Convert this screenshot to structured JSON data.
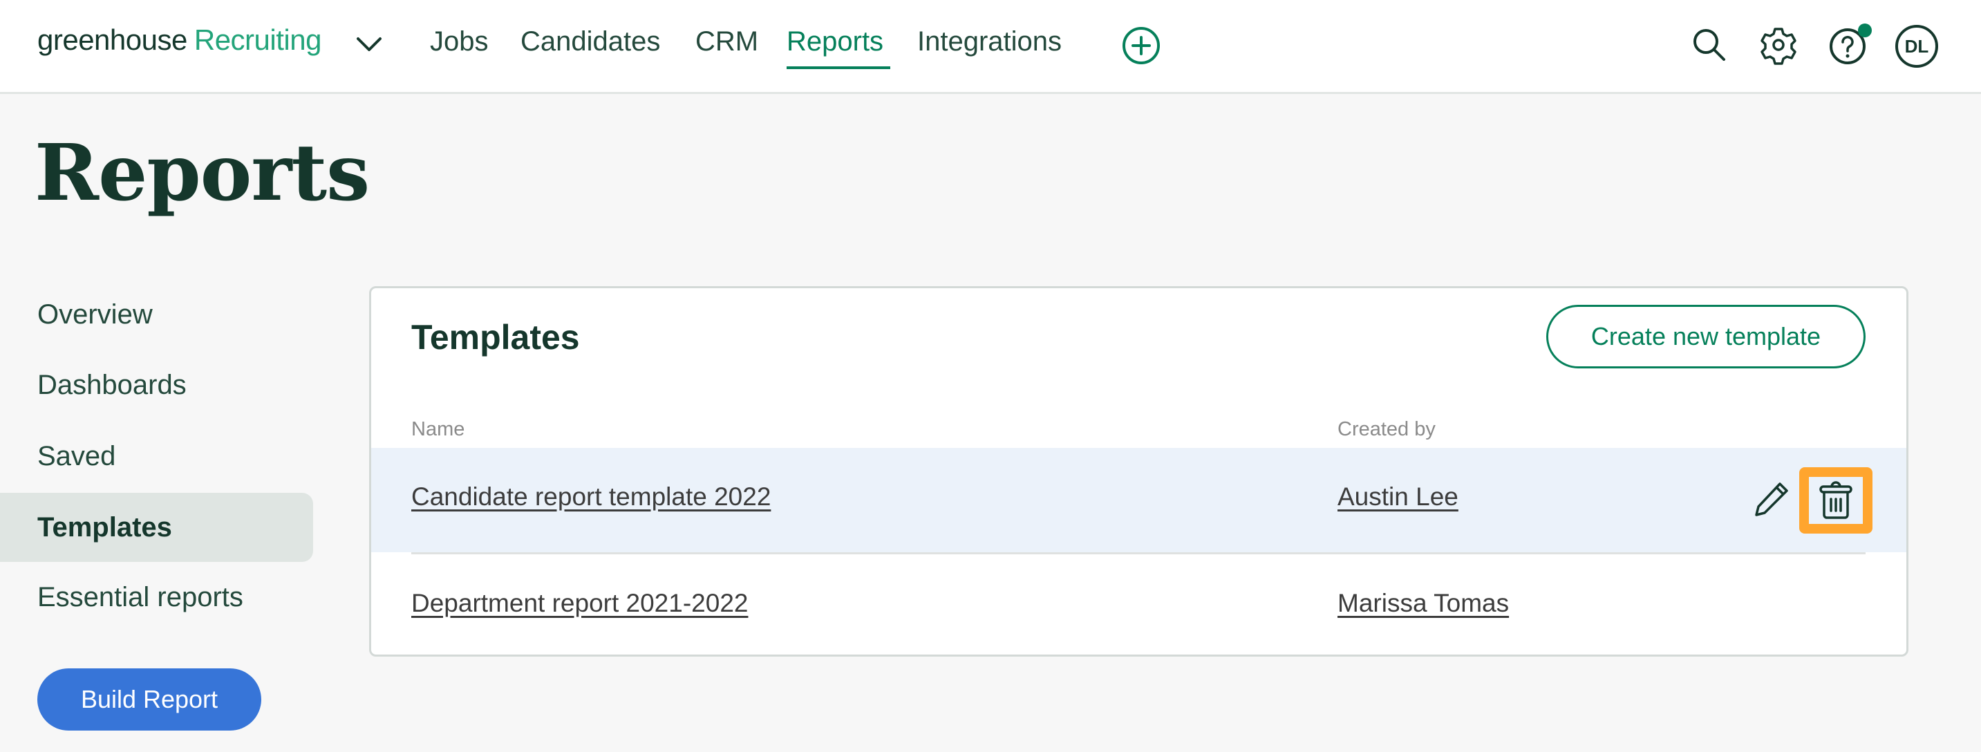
{
  "header": {
    "logo": {
      "brand": "greenhouse",
      "product": "Recruiting"
    },
    "nav": [
      {
        "label": "Jobs",
        "active": false
      },
      {
        "label": "Candidates",
        "active": false
      },
      {
        "label": "CRM",
        "active": false
      },
      {
        "label": "Reports",
        "active": true
      },
      {
        "label": "Integrations",
        "active": false
      }
    ],
    "icons": {
      "add": "plus-circle-icon",
      "search": "search-icon",
      "settings": "gear-icon",
      "help": "help-icon",
      "help_has_notification": true
    },
    "avatar_initials": "DL"
  },
  "page": {
    "title": "Reports"
  },
  "sidebar": {
    "items": [
      {
        "label": "Overview",
        "active": false
      },
      {
        "label": "Dashboards",
        "active": false
      },
      {
        "label": "Saved",
        "active": false
      },
      {
        "label": "Templates",
        "active": true
      },
      {
        "label": "Essential reports",
        "active": false
      }
    ],
    "build_button": "Build Report"
  },
  "templates": {
    "title": "Templates",
    "create_button": "Create new template",
    "columns": {
      "name": "Name",
      "created_by": "Created by"
    },
    "rows": [
      {
        "name": "Candidate report template 2022",
        "created_by": "Austin Lee",
        "hovered": true,
        "actions": [
          "edit",
          "delete"
        ]
      },
      {
        "name": "Department report 2021-2022",
        "created_by": "Marissa Tomas",
        "hovered": false,
        "actions": []
      }
    ]
  },
  "colors": {
    "brand_green": "#05805a",
    "logo_green": "#23a47a",
    "dark_text": "#15372c",
    "primary_blue": "#3775d8",
    "highlight_orange": "#ffa52e",
    "row_hover": "#ebf2fa",
    "sidebar_active": "#dfe5e2"
  }
}
